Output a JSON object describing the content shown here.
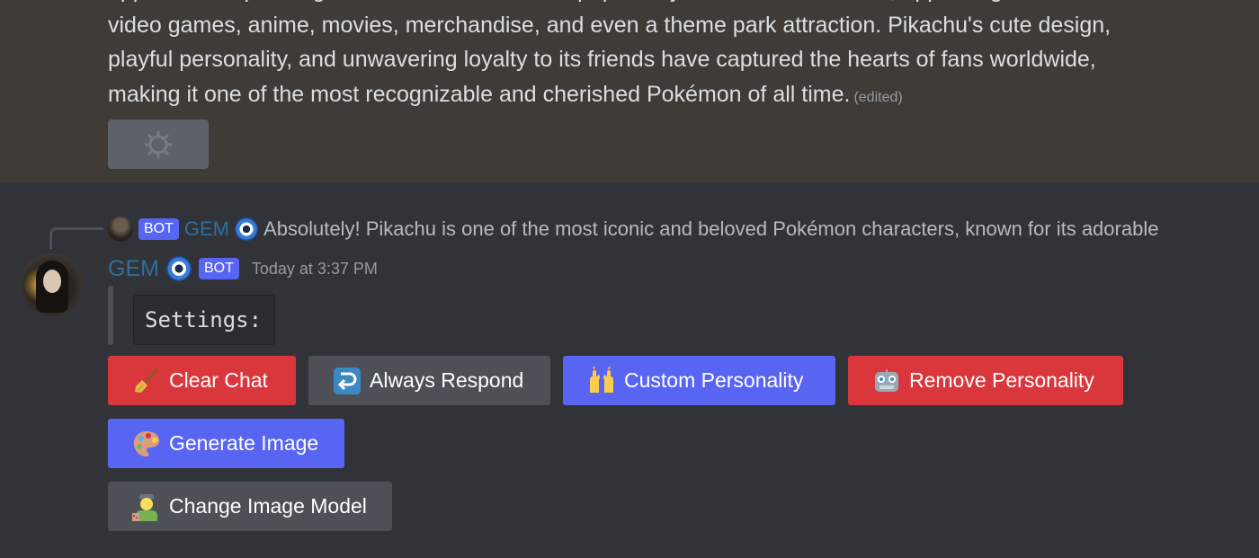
{
  "previous_message": {
    "lines": [
      "appeared in spin-off games and has become a popular symbol of the franchise, appearing in",
      "video games, anime, movies, merchandise, and even a theme park attraction. Pikachu's cute design,",
      "playful personality, and unwavering loyalty to its friends have captured the hearts of fans worldwide,",
      "making it one of the most recognizable and cherished Pokémon of all time."
    ],
    "edited_label": "(edited)"
  },
  "reply": {
    "bot_tag": "BOT",
    "name": "GEM",
    "text": "Absolutely! Pikachu is one of the most iconic and beloved Pokémon characters, known for its adorable"
  },
  "message": {
    "author": "GEM",
    "bot_tag": "BOT",
    "timestamp": "Today at 3:37 PM",
    "code_text": "Settings:"
  },
  "buttons": {
    "clear_chat": "Clear Chat",
    "always_respond": "Always Respond",
    "custom_personality": "Custom Personality",
    "remove_personality": "Remove Personality",
    "generate_image": "Generate Image",
    "change_image_model": "Change Image Model"
  },
  "icons": {
    "clear_chat": "broom-icon",
    "always_respond": "return-arrow-icon",
    "custom_personality": "raised-hands-icon",
    "remove_personality": "robot-icon",
    "generate_image": "palette-icon",
    "change_image_model": "artist-icon",
    "name_badge": "nazar-amulet-icon"
  },
  "colors": {
    "background": "#313338",
    "highlight": "#3f3c37",
    "danger": "#da373c",
    "secondary": "#4e5058",
    "primary": "#5865f2",
    "username": "#2f6f9a"
  }
}
